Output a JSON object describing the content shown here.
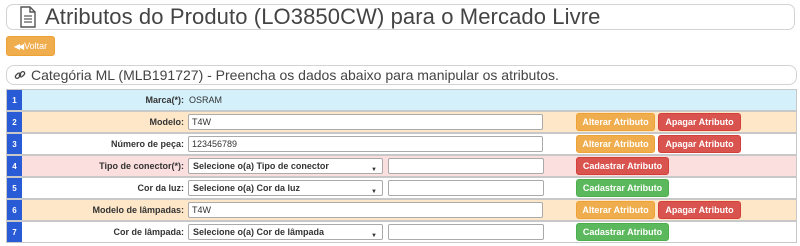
{
  "header": {
    "title": "Atributos do Produto (LO3850CW) para o Mercado Livre",
    "icon": "document-icon"
  },
  "back_button": {
    "label": "Voltar",
    "icon": "double-chevron-left-icon"
  },
  "category": {
    "text": "Categória ML (MLB191727) - Preencha os dados abaixo para manipular os atributos.",
    "icon": "link-icon"
  },
  "colors": {
    "row_blue": "#d4f1fb",
    "row_orange": "#fde7c8",
    "row_red": "#fbdede",
    "row_white": "#ffffff",
    "num_badge": "#2a5bd7",
    "alter": "#f0ad4e",
    "delete": "#d9534f",
    "register": "#5cb85c"
  },
  "buttons": {
    "alter": "Alterar Atributo",
    "delete": "Apagar Atributo",
    "register": "Cadastrar Atributo"
  },
  "rows": [
    {
      "num": "1",
      "label": "Marca(*):",
      "kind": "static",
      "value": "OSRAM",
      "actions": []
    },
    {
      "num": "2",
      "label": "Modelo:",
      "kind": "text",
      "value": "T4W",
      "actions": [
        "alter",
        "delete"
      ]
    },
    {
      "num": "3",
      "label": "Número de peça:",
      "kind": "text",
      "value": "123456789",
      "actions": [
        "alter",
        "delete"
      ]
    },
    {
      "num": "4",
      "label": "Tipo de conector(*):",
      "kind": "select",
      "value": "Selecione o(a) Tipo de conector",
      "actions": [
        "register-red"
      ]
    },
    {
      "num": "5",
      "label": "Cor da luz:",
      "kind": "select",
      "value": "Selecione o(a) Cor da luz",
      "actions": [
        "register"
      ]
    },
    {
      "num": "6",
      "label": "Modelo de lâmpadas:",
      "kind": "text",
      "value": "T4W",
      "actions": [
        "alter",
        "delete"
      ]
    },
    {
      "num": "7",
      "label": "Cor de lâmpada:",
      "kind": "select",
      "value": "Selecione o(a) Cor de lâmpada",
      "actions": [
        "register"
      ]
    }
  ]
}
